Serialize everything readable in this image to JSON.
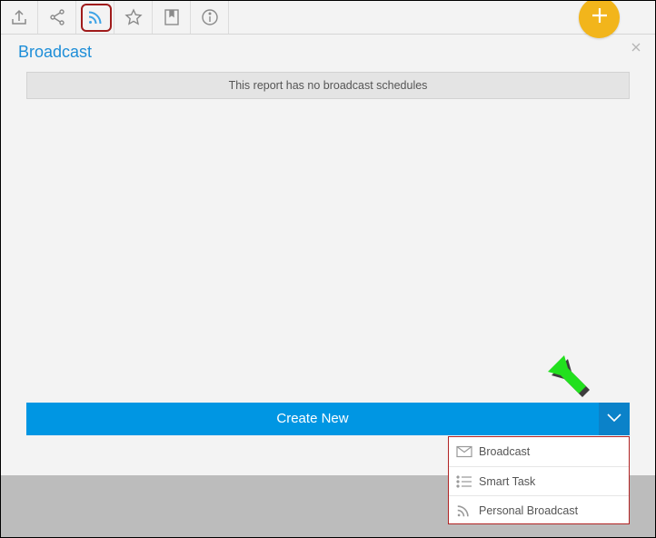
{
  "toolbar": {
    "buttons": [
      {
        "name": "export-button",
        "icon": "upload-icon"
      },
      {
        "name": "share-button",
        "icon": "share-icon"
      },
      {
        "name": "broadcast-button",
        "icon": "rss-icon",
        "active": true
      },
      {
        "name": "favourite-button",
        "icon": "star-icon"
      },
      {
        "name": "bookmark-button",
        "icon": "bookmark-icon"
      },
      {
        "name": "info-button",
        "icon": "info-icon"
      }
    ],
    "add_button_icon": "plus-icon"
  },
  "panel": {
    "title": "Broadcast",
    "empty_message": "This report has no broadcast schedules",
    "close_icon": "close-icon"
  },
  "create": {
    "label": "Create New",
    "toggle_icon": "chevron-down-icon"
  },
  "menu": {
    "items": [
      {
        "label": "Broadcast",
        "icon": "envelope-icon"
      },
      {
        "label": "Smart Task",
        "icon": "list-icon"
      },
      {
        "label": "Personal Broadcast",
        "icon": "rss-icon"
      }
    ]
  },
  "colors": {
    "accent": "#0096e3",
    "accent_dark": "#0b82c9",
    "title": "#1e8ed8",
    "fab": "#f2b51b",
    "highlight": "#a01b1b",
    "pointer": "#22e01e"
  }
}
